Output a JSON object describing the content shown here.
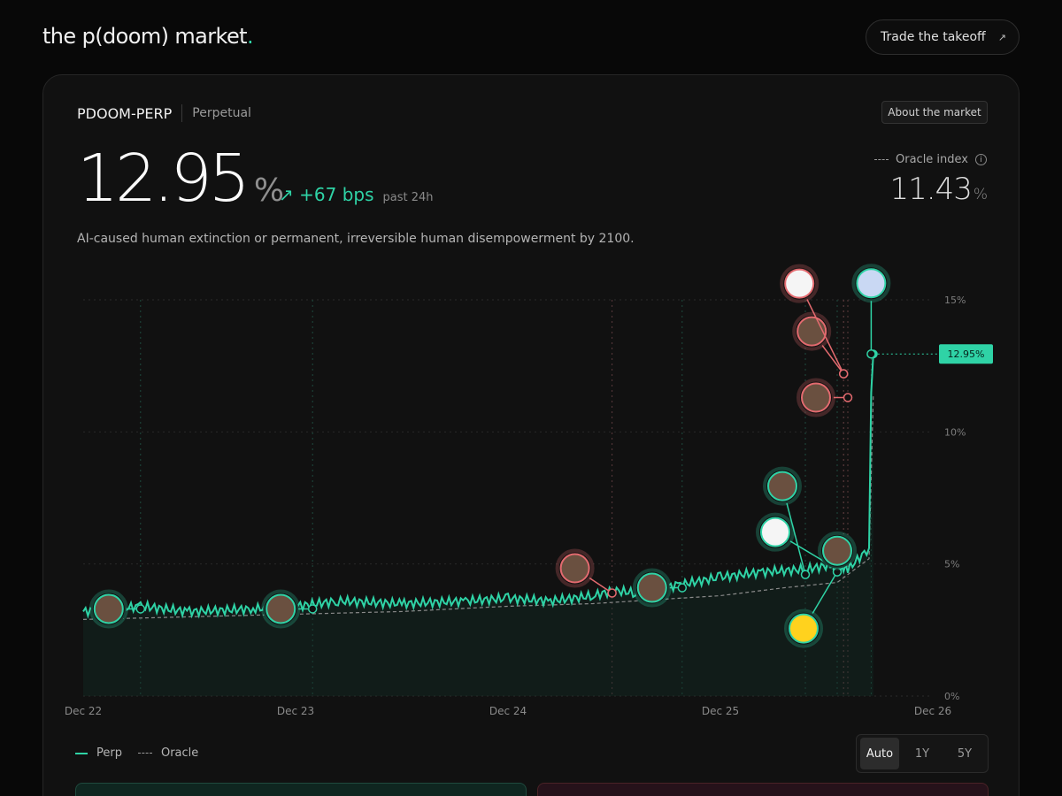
{
  "header": {
    "logo_text": "the p(doom) market",
    "logo_dot": ".",
    "trade_button": "Trade the takeoff",
    "trade_arrow": "↗"
  },
  "market": {
    "ticker": "PDOOM-PERP",
    "type": "Perpetual",
    "about_button": "About the market",
    "price": "12.95",
    "price_unit": "%",
    "change": "+67 bps",
    "change_arrow": "↗",
    "change_period": "past 24h",
    "description": "AI-caused human extinction or permanent, irreversible human disempowerment by 2100."
  },
  "oracle": {
    "label": "Oracle index",
    "info_glyph": "i",
    "value": "11.43",
    "unit": "%"
  },
  "chart_data": {
    "type": "line",
    "x_ticks": [
      "Dec 22",
      "Dec 23",
      "Dec 24",
      "Dec 25",
      "Dec 26"
    ],
    "y_ticks": [
      "0%",
      "5%",
      "10%",
      "15%"
    ],
    "ylim": [
      0,
      15
    ],
    "grid": true,
    "current_label": "12.95%",
    "series": [
      {
        "name": "Perp",
        "color": "#2fd3a6",
        "style": "solid",
        "x": [
          22.0,
          22.27,
          22.5,
          22.8,
          23.0,
          23.2,
          23.5,
          23.8,
          24.0,
          24.2,
          24.4,
          24.5,
          24.6,
          24.8,
          25.0,
          25.2,
          25.4,
          25.55,
          25.6,
          25.7,
          25.71,
          25.72
        ],
        "values": [
          3.2,
          3.4,
          3.2,
          3.3,
          3.4,
          3.6,
          3.5,
          3.6,
          3.7,
          3.6,
          3.8,
          4.0,
          3.9,
          4.2,
          4.5,
          4.7,
          4.8,
          5.0,
          4.8,
          5.6,
          11.5,
          12.95
        ]
      },
      {
        "name": "Oracle",
        "color": "#8a8a8a",
        "style": "dashed",
        "x": [
          22.0,
          22.5,
          23.0,
          23.5,
          24.0,
          24.4,
          24.6,
          25.0,
          25.3,
          25.55,
          25.7,
          25.72
        ],
        "values": [
          2.9,
          3.0,
          3.1,
          3.2,
          3.4,
          3.5,
          3.6,
          3.8,
          4.1,
          4.3,
          5.2,
          11.43
        ]
      }
    ],
    "events": [
      {
        "x": 22.27,
        "value": 3.3,
        "icon": "person-avatar-icon",
        "side": "up"
      },
      {
        "x": 23.08,
        "value": 3.3,
        "icon": "person-avatar-icon",
        "side": "up"
      },
      {
        "x": 24.49,
        "value": 3.9,
        "icon": "person-avatar-icon",
        "side": "down"
      },
      {
        "x": 24.82,
        "value": 4.1,
        "icon": "person-avatar-icon",
        "side": "up"
      },
      {
        "x": 25.4,
        "value": 4.6,
        "icon": "person-avatar-icon",
        "side": "up"
      },
      {
        "x": 25.55,
        "value": 4.8,
        "icon": "anthropic-logo-icon",
        "side": "up"
      },
      {
        "x": 25.55,
        "value": 4.7,
        "icon": "huggingface-logo-icon",
        "side": "up"
      },
      {
        "x": 25.55,
        "value": 5.5,
        "icon": "person-avatar-icon",
        "side": "up"
      },
      {
        "x": 25.6,
        "value": 11.3,
        "icon": "person-avatar-icon",
        "side": "down"
      },
      {
        "x": 25.58,
        "value": 12.2,
        "icon": "person-avatar-icon",
        "side": "down"
      },
      {
        "x": 25.58,
        "value": 12.2,
        "icon": "openai-logo-icon",
        "side": "down"
      },
      {
        "x": 25.71,
        "value": 12.95,
        "icon": "deepseek-logo-icon",
        "side": "up"
      }
    ]
  },
  "legend": {
    "perp": "Perp",
    "oracle": "Oracle"
  },
  "range": {
    "options": [
      "Auto",
      "1Y",
      "5Y"
    ],
    "active": "Auto"
  },
  "colors": {
    "accent": "#2fd3a6",
    "negative": "#e36a6f",
    "background": "#080808",
    "card": "#111111"
  }
}
